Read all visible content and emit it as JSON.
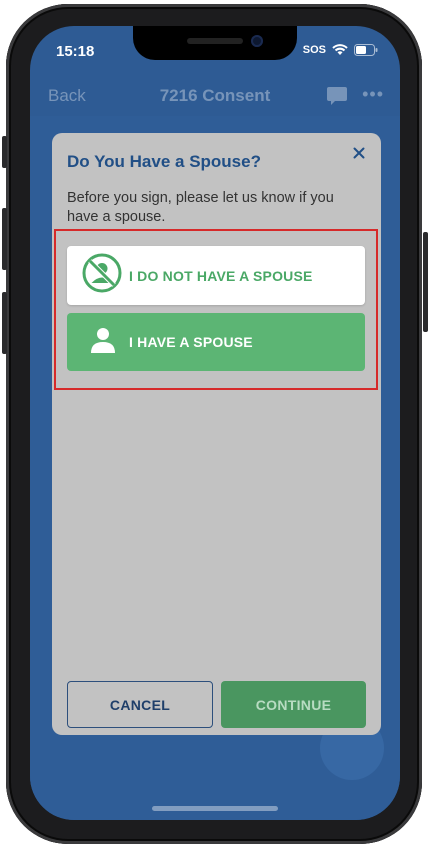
{
  "status_bar": {
    "time": "15:18",
    "carrier_label": "SOS"
  },
  "app_nav": {
    "back_label": "Back",
    "title": "7216 Consent",
    "more_label": "•••"
  },
  "modal": {
    "title": "Do You Have a Spouse?",
    "description": "Before you sign, please let us know if you have a spouse.",
    "options": [
      {
        "label": "I DO NOT HAVE A SPOUSE",
        "icon": "no-person-icon"
      },
      {
        "label": "I HAVE A SPOUSE",
        "icon": "person-icon"
      }
    ],
    "cancel_label": "CANCEL",
    "continue_label": "CONTINUE"
  },
  "colors": {
    "brand_blue": "#214f86",
    "app_background": "#2e5b94",
    "option_green": "#5cb574",
    "continue_green": "#4a9660",
    "highlight_red": "#d62a2a"
  }
}
